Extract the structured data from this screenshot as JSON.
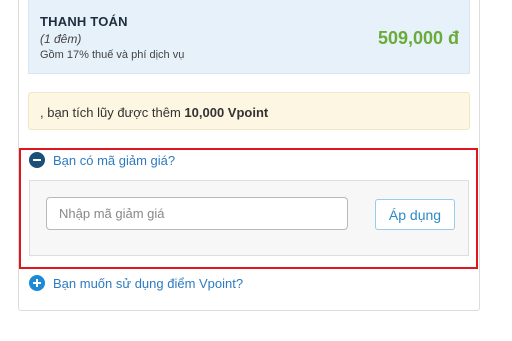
{
  "payment": {
    "title": "THANH TOÁN",
    "nights": "(1 đêm)",
    "tax_note": "Gồm 17% thuế và phí dịch vụ",
    "amount": "509,000 đ"
  },
  "vpoint_notice": {
    "prefix": ", bạn tích lũy được thêm ",
    "points": "10,000 Vpoint"
  },
  "coupon": {
    "toggle_label": "Bạn có mã giảm giá?",
    "toggle_icon": "minus-circle-icon",
    "input_value": "",
    "input_placeholder": "Nhập mã giảm giá",
    "apply_label": "Áp dụng"
  },
  "vpoint_use": {
    "toggle_label": "Bạn muốn sử dụng điểm Vpoint?",
    "toggle_icon": "plus-circle-icon"
  },
  "colors": {
    "amount_green": "#6aab3a",
    "link_blue": "#2d7bbf",
    "highlight_red": "#e0161e",
    "payment_bg": "#e6f1fa",
    "notice_bg": "#fdf6e3"
  }
}
